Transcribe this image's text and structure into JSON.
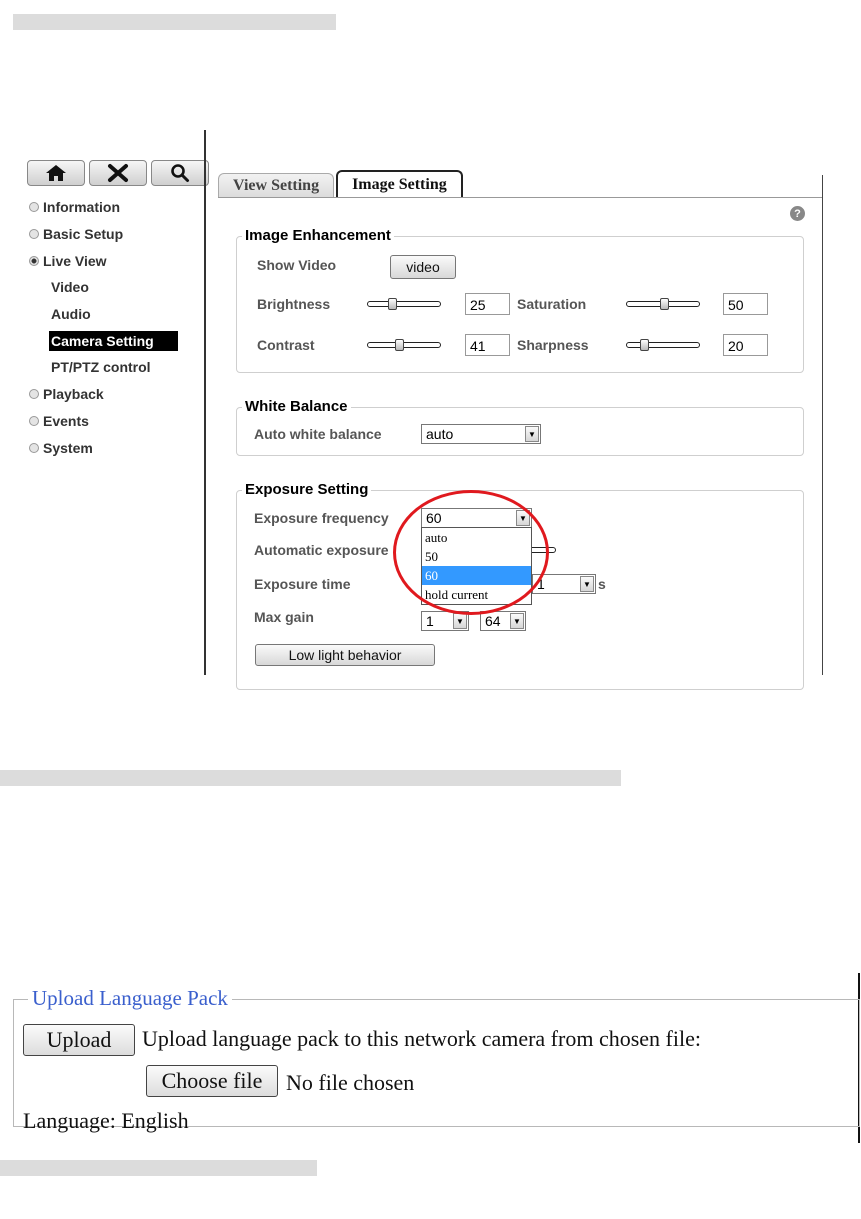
{
  "toolbar": {
    "icons": [
      "home-icon",
      "tools-icon",
      "search-icon"
    ]
  },
  "nav": {
    "information": "Information",
    "basic_setup": "Basic Setup",
    "live_view": "Live View",
    "video": "Video",
    "audio": "Audio",
    "camera_setting": "Camera Setting",
    "ptz_control": "PT/PTZ control",
    "playback": "Playback",
    "events": "Events",
    "system": "System"
  },
  "tabs": {
    "view_setting": "View Setting",
    "image_setting": "Image Setting"
  },
  "help_glyph": "?",
  "image_enhancement": {
    "legend": "Image Enhancement",
    "show_video_label": "Show Video",
    "video_button": "video",
    "brightness_label": "Brightness",
    "brightness_value": "25",
    "saturation_label": "Saturation",
    "saturation_value": "50",
    "contrast_label": "Contrast",
    "contrast_value": "41",
    "sharpness_label": "Sharpness",
    "sharpness_value": "20"
  },
  "white_balance": {
    "legend": "White Balance",
    "auto_label": "Auto white balance",
    "auto_value": "auto"
  },
  "exposure": {
    "legend": "Exposure Setting",
    "frequency_label": "Exposure frequency",
    "frequency_value": "60",
    "frequency_options": [
      "auto",
      "50",
      "60",
      "hold current"
    ],
    "frequency_highlighted": "60",
    "automatic_label": "Automatic exposure",
    "time_label": "Exposure time",
    "time_value": "1",
    "time_unit": "s",
    "max_gain_label": "Max gain",
    "max_gain_min": "1",
    "max_gain_max": "64",
    "low_light_button": "Low light behavior"
  },
  "language_pack": {
    "legend": "Upload Language Pack",
    "upload_button": "Upload",
    "upload_text": "Upload language pack to this network camera from chosen file:",
    "choose_file_button": "Choose file",
    "no_file_text": "No file chosen",
    "language_text": "Language: English"
  },
  "colors": {
    "highlight": "#3399ff",
    "annotation_circle": "#e0191e",
    "legend_blue": "#3a5fcd"
  }
}
